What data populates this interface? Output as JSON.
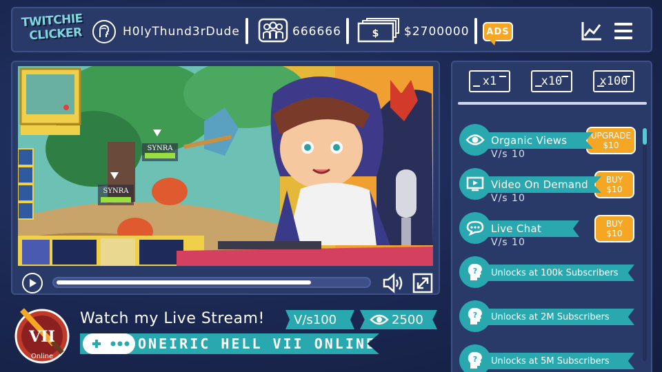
{
  "header": {
    "logo_line1": "TWITCHIE",
    "logo_line2": "CLICKER",
    "username": "H0lyThund3rDude",
    "subscribers": "666666",
    "money": "$2700000",
    "ads_label": "ADS"
  },
  "icons": {
    "user": "user-avatar-icon",
    "subscribers": "people-group-icon",
    "money": "cash-stack-icon",
    "ads": "ads-speech-icon",
    "stats": "line-chart-icon",
    "menu": "hamburger-menu-icon",
    "play": "play-icon",
    "volume": "volume-icon",
    "fullscreen": "fullscreen-icon",
    "controller": "gamepad-icon",
    "eye": "eye-icon",
    "video": "video-screen-icon",
    "chat": "chat-bubble-icon",
    "lock": "question-head-icon"
  },
  "video": {
    "progress": 0.82,
    "enemy_label_1": "SYNRA",
    "enemy_label_2": "SYNRA"
  },
  "stream": {
    "title": "Watch my Live Stream!",
    "views_per_sec": "V/s100",
    "viewers": "2500",
    "game_name": "ONEIRIC HELL VII ONLINE",
    "badge_text": "VII",
    "badge_sub": "Online"
  },
  "multipliers": [
    "x1",
    "x10",
    "x100"
  ],
  "upgrades": [
    {
      "name": "Organic Views",
      "rate": "V/s 10",
      "action_top": "UPGRADE",
      "action_bottom": "$10"
    },
    {
      "name": "Video On Demand",
      "rate": "V/s 10",
      "action_top": "BUY",
      "action_bottom": "$10"
    },
    {
      "name": "Live Chat",
      "rate": "V/s 10",
      "action_top": "BUY",
      "action_bottom": "$10"
    }
  ],
  "locked": [
    "Unlocks at 100k Subscribers",
    "Unlocks at 2M Subscribers",
    "Unlocks at 5M Subscribers"
  ],
  "colors": {
    "background": "#1a2750",
    "panel": "#2a3a68",
    "accent_teal": "#2aa8b0",
    "accent_orange": "#f5a623"
  }
}
